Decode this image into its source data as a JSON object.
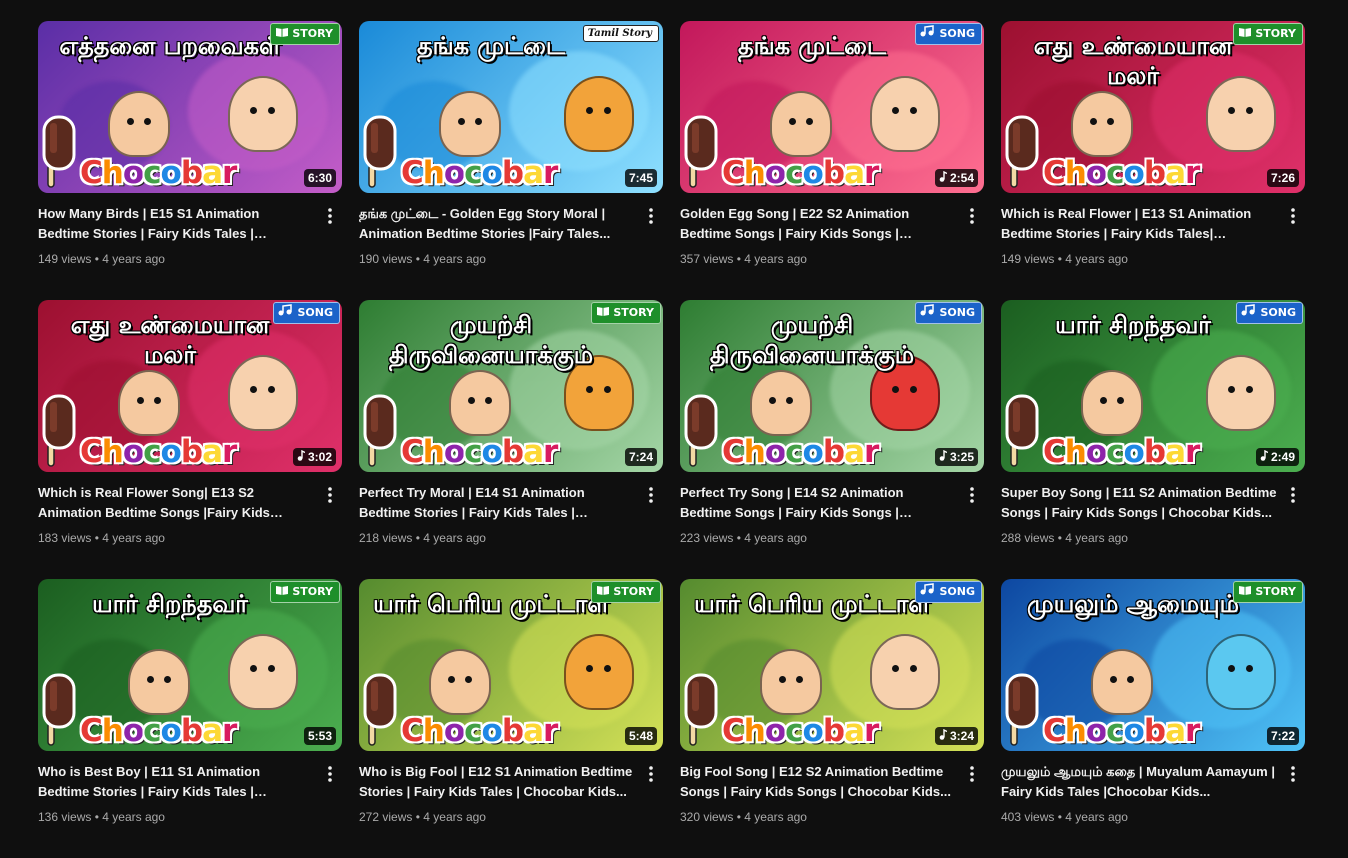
{
  "brand_name": "Chocobar",
  "colors": {
    "background": "#0f0f0f",
    "story_tag": "#1e8f2a",
    "song_tag": "#1b63c9",
    "meta_text": "#aaaaaa"
  },
  "videos": [
    {
      "thumb_text": "எத்தனை பறவைகள்",
      "tag": "STORY",
      "tag_type": "story",
      "tag_icon": "book-icon",
      "duration": "6:30",
      "is_song": false,
      "title": "How Many Birds | E15 S1 Animation Bedtime Stories | Fairy Kids Tales | Chocobar Kids...",
      "views": "149 views",
      "age": "4 years ago",
      "bg": [
        "#5a2ea6",
        "#c45dc8"
      ]
    },
    {
      "thumb_text": "தங்க முட்டை",
      "tag": "Tamil Story",
      "tag_type": "badge-tamil",
      "tag_icon": "",
      "duration": "7:45",
      "is_song": false,
      "title": "தங்க முட்டை - Golden Egg Story Moral | Animation Bedtime Stories |Fairy Tales...",
      "views": "190 views",
      "age": "4 years ago",
      "bg": [
        "#1a8ad8",
        "#8fe0ff"
      ]
    },
    {
      "thumb_text": "தங்க முட்டை",
      "tag": "SONG",
      "tag_type": "song",
      "tag_icon": "music-note-icon",
      "duration": "2:54",
      "is_song": true,
      "title": "Golden Egg Song | E22 S2 Animation Bedtime Songs | Fairy Kids Songs | Chocob...",
      "views": "357 views",
      "age": "4 years ago",
      "bg": [
        "#c2185b",
        "#ff6f91"
      ]
    },
    {
      "thumb_text": "எது உண்மையான மலர்",
      "tag": "STORY",
      "tag_type": "story",
      "tag_icon": "book-icon",
      "duration": "7:26",
      "is_song": false,
      "title": "Which is Real Flower | E13 S1 Animation Bedtime Stories | Fairy Kids Tales| Chocoba...",
      "views": "149 views",
      "age": "4 years ago",
      "bg": [
        "#9c1030",
        "#e0306a"
      ]
    },
    {
      "thumb_text": "எது உண்மையான மலர்",
      "tag": "SONG",
      "tag_type": "song",
      "tag_icon": "music-note-icon",
      "duration": "3:02",
      "is_song": true,
      "title": "Which is Real Flower Song| E13 S2 Animation Bedtime Songs |Fairy Kids Song...",
      "views": "183 views",
      "age": "4 years ago",
      "bg": [
        "#9c1030",
        "#e0306a"
      ]
    },
    {
      "thumb_text": "முயற்சி திருவினையாக்கும்",
      "tag": "STORY",
      "tag_type": "story",
      "tag_icon": "book-icon",
      "duration": "7:24",
      "is_song": false,
      "title": "Perfect Try Moral | E14 S1 Animation Bedtime Stories | Fairy Kids Tales | Chocob...",
      "views": "218 views",
      "age": "4 years ago",
      "bg": [
        "#2e7d32",
        "#a5d6a7"
      ]
    },
    {
      "thumb_text": "முயற்சி திருவினையாக்கும்",
      "tag": "SONG",
      "tag_type": "song",
      "tag_icon": "music-note-icon",
      "duration": "3:25",
      "is_song": true,
      "title": "Perfect Try Song | E14 S2 Animation Bedtime Songs | Fairy Kids Songs | Chocob...",
      "views": "223 views",
      "age": "4 years ago",
      "bg": [
        "#2e7d32",
        "#a5d6a7"
      ]
    },
    {
      "thumb_text": "யார் சிறந்தவர்",
      "tag": "SONG",
      "tag_type": "song",
      "tag_icon": "music-note-icon",
      "duration": "2:49",
      "is_song": true,
      "title": "Super Boy Song | E11 S2 Animation Bedtime Songs | Fairy Kids Songs | Chocobar Kids...",
      "views": "288 views",
      "age": "4 years ago",
      "bg": [
        "#1b5e20",
        "#4caf50"
      ]
    },
    {
      "thumb_text": "யார் சிறந்தவர்",
      "tag": "STORY",
      "tag_type": "story",
      "tag_icon": "book-icon",
      "duration": "5:53",
      "is_song": false,
      "title": "Who is Best Boy | E11 S1 Animation Bedtime Stories | Fairy Kids Tales | Chocobar Kids...",
      "views": "136 views",
      "age": "4 years ago",
      "bg": [
        "#1b5e20",
        "#4caf50"
      ]
    },
    {
      "thumb_text": "யார் பெரிய முட்டாள்",
      "tag": "STORY",
      "tag_type": "story",
      "tag_icon": "book-icon",
      "duration": "5:48",
      "is_song": false,
      "title": "Who is Big Fool | E12 S1 Animation Bedtime Stories | Fairy Kids Tales | Chocobar Kids...",
      "views": "272 views",
      "age": "4 years ago",
      "bg": [
        "#558b2f",
        "#d4e157"
      ]
    },
    {
      "thumb_text": "யார் பெரிய முட்டாள்",
      "tag": "SONG",
      "tag_type": "song",
      "tag_icon": "music-note-icon",
      "duration": "3:24",
      "is_song": true,
      "title": "Big Fool Song | E12 S2 Animation Bedtime Songs | Fairy Kids Songs | Chocobar Kids...",
      "views": "320 views",
      "age": "4 years ago",
      "bg": [
        "#558b2f",
        "#d4e157"
      ]
    },
    {
      "thumb_text": "முயலும் ஆமையும்",
      "tag": "STORY",
      "tag_type": "story",
      "tag_icon": "book-icon",
      "duration": "7:22",
      "is_song": false,
      "title": "முயலும் ஆமயும் கதை | Muyalum Aamayum | Fairy Kids Tales |Chocobar Kids...",
      "views": "403 views",
      "age": "4 years ago",
      "bg": [
        "#0d47a1",
        "#4fc3f7"
      ]
    }
  ]
}
